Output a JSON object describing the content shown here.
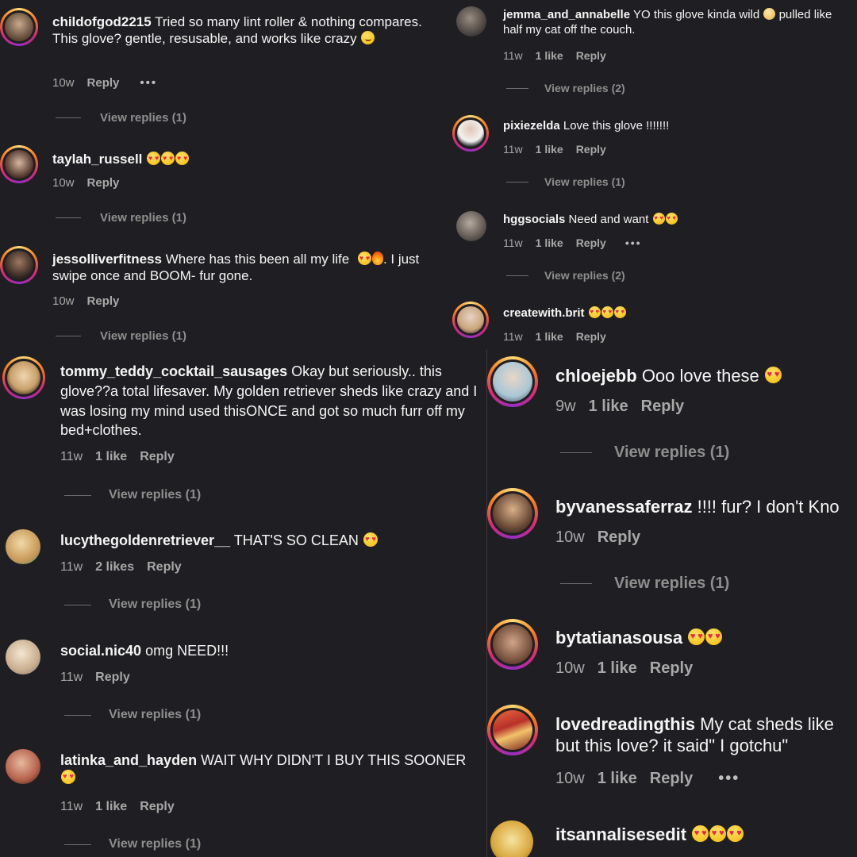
{
  "meta_labels": {
    "reply": "Reply",
    "more": "•••"
  },
  "panel_top_left": {
    "comments": [
      {
        "username": "childofgod2215",
        "text": "Tried so many lint roller & nothing compares. This glove? gentle, resusable, and works like crazy",
        "time": "10w",
        "likes": "",
        "view_replies": "View replies (1)"
      },
      {
        "username": "taylah_russell",
        "text": "",
        "time": "10w",
        "likes": "",
        "view_replies": "View replies (1)"
      },
      {
        "username": "jessolliverfitness",
        "text_a": "Where has this been all my life",
        "text_b": ". I just swipe once and BOOM- fur gone.",
        "time": "10w",
        "likes": "",
        "view_replies": "View replies (1)"
      }
    ]
  },
  "panel_top_right": {
    "comments": [
      {
        "username": "jemma_and_annabelle",
        "text_a": "YO this glove kinda wild",
        "text_b": "pulled like half my cat off the couch.",
        "time": "11w",
        "likes": "1 like",
        "view_replies": "View replies (2)"
      },
      {
        "username": "pixiezelda",
        "text": "Love this glove !!!!!!!",
        "time": "11w",
        "likes": "1 like",
        "view_replies": "View replies (1)"
      },
      {
        "username": "hggsocials",
        "text": "Need and want",
        "time": "11w",
        "likes": "1 like",
        "view_replies": "View replies (2)"
      },
      {
        "username": "createwith.brit",
        "text": "",
        "time": "11w",
        "likes": "1 like",
        "view_replies": ""
      }
    ]
  },
  "panel_bottom_left": {
    "comments": [
      {
        "username": "tommy_teddy_cocktail_sausages",
        "text": "Okay but seriously.. this glove??a total lifesaver. My golden retriever sheds like crazy and I was losing my mind used thisONCE and got so much furr off my bed+clothes.",
        "time": "11w",
        "likes": "1 like",
        "view_replies": "View replies (1)"
      },
      {
        "username": "lucythegoldenretriever__",
        "text": "THAT'S SO CLEAN",
        "time": "11w",
        "likes": "2 likes",
        "view_replies": "View replies (1)"
      },
      {
        "username": "social.nic40",
        "text": "omg NEED!!!",
        "time": "11w",
        "likes": "",
        "view_replies": "View replies (1)"
      },
      {
        "username": "latinka_and_hayden",
        "text": "WAIT WHY DIDN'T I BUY THIS SOONER",
        "time": "11w",
        "likes": "1 like",
        "view_replies": "View replies (1)"
      }
    ]
  },
  "panel_bottom_right": {
    "comments": [
      {
        "username": "chloejebb",
        "text": "Ooo love these",
        "time": "9w",
        "likes": "1 like",
        "view_replies": "View replies (1)"
      },
      {
        "username": "byvanessaferraz",
        "text": "!!!! fur? I don't Kno",
        "time": "10w",
        "likes": "",
        "view_replies": "View replies (1)"
      },
      {
        "username": "bytatianasousa",
        "text": "",
        "time": "10w",
        "likes": "1 like",
        "view_replies": ""
      },
      {
        "username": "lovedreadingthis",
        "text": "My cat sheds like but this love? it said\" I gotchu\"",
        "time": "10w",
        "likes": "1 like",
        "view_replies": ""
      },
      {
        "username": "itsannalisesedit",
        "text": "",
        "time": "",
        "likes": "",
        "view_replies": ""
      }
    ]
  },
  "colors": {
    "background": "#1f1f23",
    "text": "#f5f5f5",
    "muted": "#a8a8a8",
    "story_ring": [
      "#feda75",
      "#fa7e1e",
      "#d62976",
      "#962fbf"
    ]
  },
  "emoji_names": [
    "smiling-face-with-hearts",
    "heart-eyes",
    "fire",
    "clapping-hands"
  ]
}
